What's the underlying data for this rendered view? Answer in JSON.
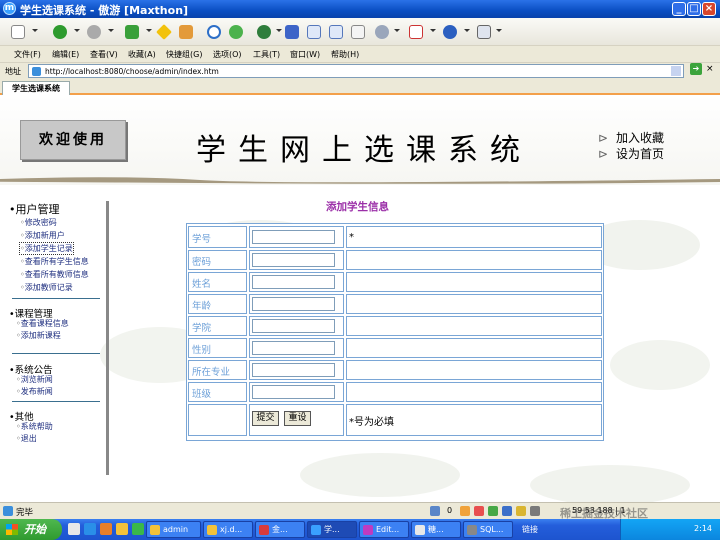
{
  "window": {
    "title": "学生选课系统 - 傲游 [Maxthon]"
  },
  "menu": [
    "文件(F)",
    "编辑(E)",
    "查看(V)",
    "收藏(A)",
    "快捷组(G)",
    "选项(O)",
    "工具(T)",
    "窗口(W)",
    "帮助(H)"
  ],
  "address": {
    "label": "地址",
    "url": "http://localhost:8080/choose/admin/index.htm"
  },
  "tab": {
    "label": "学生选课系统"
  },
  "banner": {
    "welcome": "欢迎使用",
    "site_title": "学生网上选课系统",
    "link_favorite": "加入收藏",
    "link_home": "设为首页"
  },
  "sidebar": {
    "user_mgmt": "用户管理",
    "user_items": [
      "修改密码",
      "添加新用户",
      "添加学生记录",
      "查看所有学生信息",
      "查看所有教师信息",
      "添加教师记录"
    ],
    "course_mgmt": "课程管理",
    "course_items": [
      "查看课程信息",
      "添加新课程"
    ],
    "notice": "系统公告",
    "notice_items": [
      "浏览新闻",
      "发布新闻"
    ],
    "other": "其他",
    "other_items": [
      "系统帮助",
      "退出"
    ]
  },
  "form": {
    "title": "添加学生信息",
    "fields": [
      {
        "label": "学号",
        "value": "",
        "note": "*"
      },
      {
        "label": "密码",
        "value": "",
        "note": ""
      },
      {
        "label": "姓名",
        "value": "",
        "note": ""
      },
      {
        "label": "年龄",
        "value": "",
        "note": ""
      },
      {
        "label": "学院",
        "value": "",
        "note": ""
      },
      {
        "label": "性别",
        "value": "",
        "note": ""
      },
      {
        "label": "所在专业",
        "value": "",
        "note": ""
      },
      {
        "label": "班级",
        "value": "",
        "note": ""
      }
    ],
    "submit_label": "提交",
    "reset_label": "重设",
    "required_note": "*号为必填"
  },
  "status": {
    "text": "完毕",
    "count": "0",
    "right_text": "59 53 188 | 1"
  },
  "taskbar": {
    "start": "开始",
    "tasks": [
      "admin",
      "xj.d...",
      "金...",
      "学...",
      "Edit...",
      "糖...",
      "SQL...",
      "链接"
    ],
    "time": "2:14"
  },
  "watermark": "稀土掘金技术社区",
  "colors": {
    "accent_purple": "#9b2fa8",
    "label_blue": "#6da0d8",
    "border_blue": "#7aa6d6"
  }
}
